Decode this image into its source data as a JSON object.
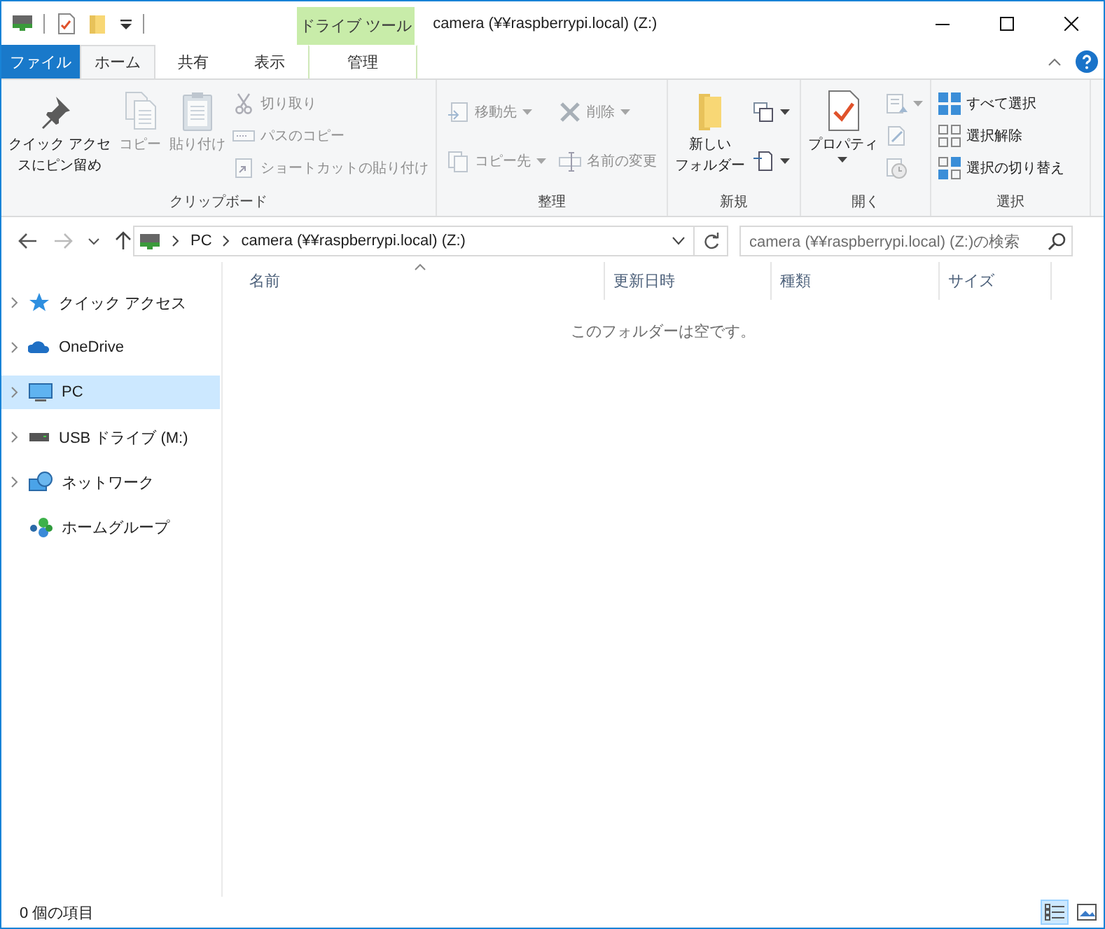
{
  "window": {
    "title": "camera (¥¥raspberrypi.local) (Z:)",
    "context_tab_group": "ドライブ ツール"
  },
  "ribbon_tabs": [
    {
      "label": "ファイル",
      "kind": "file",
      "selected": false
    },
    {
      "label": "ホーム",
      "kind": "tab",
      "selected": true
    },
    {
      "label": "共有",
      "kind": "tab",
      "selected": false
    },
    {
      "label": "表示",
      "kind": "tab",
      "selected": false
    },
    {
      "label": "管理",
      "kind": "context",
      "selected": false
    }
  ],
  "ribbon_groups": [
    {
      "label": "クリップボード",
      "commands": [
        {
          "kind": "large",
          "lines": [
            "クイック アクセ",
            "スにピン留め"
          ],
          "disabled": false,
          "dropdown": false
        },
        {
          "kind": "large",
          "lines": [
            "コピー"
          ],
          "disabled": true,
          "dropdown": false
        },
        {
          "kind": "large",
          "lines": [
            "貼り付け"
          ],
          "disabled": true,
          "dropdown": false
        },
        {
          "kind": "stack",
          "items": [
            {
              "label": "切り取り",
              "disabled": true,
              "dropdown": false
            },
            {
              "label": "パスのコピー",
              "disabled": true,
              "dropdown": false
            },
            {
              "label": "ショートカットの貼り付け",
              "disabled": true,
              "dropdown": false
            }
          ]
        }
      ]
    },
    {
      "label": "整理",
      "commands": [
        {
          "kind": "stack",
          "items": [
            {
              "label": "移動先",
              "disabled": true,
              "dropdown": true
            },
            {
              "label": "コピー先",
              "disabled": true,
              "dropdown": true
            }
          ]
        },
        {
          "kind": "stack",
          "items": [
            {
              "label": "削除",
              "disabled": true,
              "dropdown": true
            },
            {
              "label": "名前の変更",
              "disabled": true,
              "dropdown": false
            }
          ]
        }
      ]
    },
    {
      "label": "新規",
      "commands": [
        {
          "kind": "large",
          "lines": [
            "新しい",
            "フォルダー"
          ],
          "disabled": false,
          "dropdown": false
        },
        {
          "kind": "stack",
          "items": [
            {
              "disabled": false,
              "dropdown": true
            },
            {
              "disabled": false,
              "dropdown": true
            }
          ]
        }
      ]
    },
    {
      "label": "開く",
      "commands": [
        {
          "kind": "large",
          "lines": [
            "プロパティ"
          ],
          "disabled": false,
          "dropdown": true
        },
        {
          "kind": "stack",
          "items": [
            {
              "disabled": true,
              "dropdown": true
            },
            {
              "disabled": true,
              "dropdown": false
            },
            {
              "disabled": true,
              "dropdown": false
            }
          ]
        }
      ]
    },
    {
      "label": "選択",
      "commands": [
        {
          "kind": "stack",
          "items": [
            {
              "label": "すべて選択",
              "disabled": false,
              "dropdown": false
            },
            {
              "label": "選択解除",
              "disabled": false,
              "dropdown": false
            },
            {
              "label": "選択の切り替え",
              "disabled": false,
              "dropdown": false
            }
          ]
        }
      ]
    }
  ],
  "navigation": {
    "back_disabled": false,
    "forward_disabled": true
  },
  "address": {
    "crumbs": [
      "PC",
      "camera (¥¥raspberrypi.local) (Z:)"
    ]
  },
  "search": {
    "placeholder": "camera (¥¥raspberrypi.local) (Z:)の検索"
  },
  "nav_pane": {
    "items": [
      {
        "label": "クイック アクセス",
        "expandable": true,
        "selected": false
      },
      {
        "label": "OneDrive",
        "expandable": true,
        "selected": false
      },
      {
        "label": "PC",
        "expandable": true,
        "selected": true
      },
      {
        "label": "USB ドライブ (M:)",
        "expandable": true,
        "selected": false
      },
      {
        "label": "ネットワーク",
        "expandable": true,
        "selected": false
      },
      {
        "label": "ホームグループ",
        "expandable": false,
        "selected": false
      }
    ]
  },
  "file_list": {
    "columns": [
      {
        "label": "名前",
        "sorted": true
      },
      {
        "label": "更新日時",
        "sorted": false
      },
      {
        "label": "種類",
        "sorted": false
      },
      {
        "label": "サイズ",
        "sorted": false
      }
    ],
    "empty_message": "このフォルダーは空です。"
  },
  "status_bar": {
    "item_count": "0 個の項目",
    "views": [
      {
        "selected": true
      },
      {
        "selected": false
      }
    ]
  }
}
